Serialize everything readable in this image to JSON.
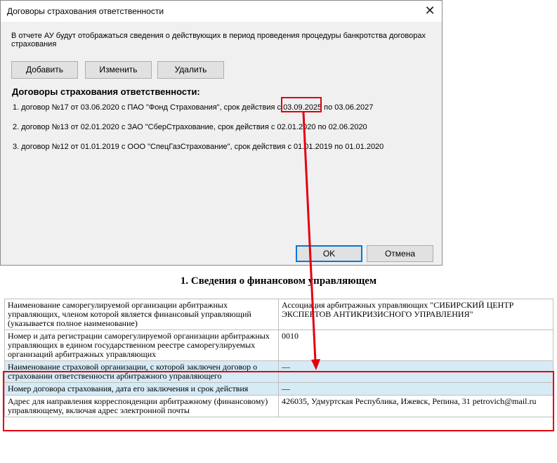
{
  "dialog": {
    "title": "Договоры страхования ответственности",
    "close_glyph": "✕",
    "info": "В отчете АУ будут отображаться сведения о действующих в период проведения процедуры банкротства договорах страхования",
    "buttons": {
      "add": "Добавить",
      "edit": "Изменить",
      "delete": "Удалить",
      "ok": "OK",
      "cancel": "Отмена"
    },
    "heading": "Договоры страхования ответственности:",
    "contracts": [
      "1. договор №17 от 03.06.2020 с ПАО \"Фонд Страхования\", срок действия с 03.09.2025 по 03.06.2027",
      "2. договор №13 от 02.01.2020 с ЗАО \"СберСтрахование, срок действия с 02.01.2020 по 02.06.2020",
      "3. договор №12 от 01.01.2019 с ООО \"СпецГазСтрахование\", срок действия с 01.01.2019 по 01.01.2020"
    ]
  },
  "section_title": "1. Сведения о финансовом управляющем",
  "table": {
    "rows": [
      {
        "label": "Наименование саморегулируемой организации арбитражных управляющих, членом которой является финансовый управляющий (указывается полное наименование)",
        "value": "Ассоциация арбитражных управляющих \"СИБИРСКИЙ ЦЕНТР ЭКСПЕРТОВ АНТИКРИЗИСНОГО УПРАВЛЕНИЯ\""
      },
      {
        "label": "Номер и дата регистрации саморегулируемой организации арбитражных управляющих в едином государственном реестре саморегулируемых организаций арбитражных управляющих",
        "value": "0010"
      },
      {
        "label": "Наименование страховой организации, с которой заключен договор о страховании ответственности арбитражного управляющего",
        "value": "—"
      },
      {
        "label": "Номер договора страхования, дата его заключения и срок действия",
        "value": "—"
      },
      {
        "label": "Адрес для направления корреспонденции арбитражному (финансовому) управляющему, включая адрес электронной почты",
        "value": "426035, Удмуртская Республика, Ижевск, Репина, 31 petrovich@mail.ru"
      }
    ]
  },
  "colors": {
    "highlight": "#e3000f",
    "row_highlight": "#d6ebf5",
    "dialog_bg": "#f0f0f0"
  }
}
